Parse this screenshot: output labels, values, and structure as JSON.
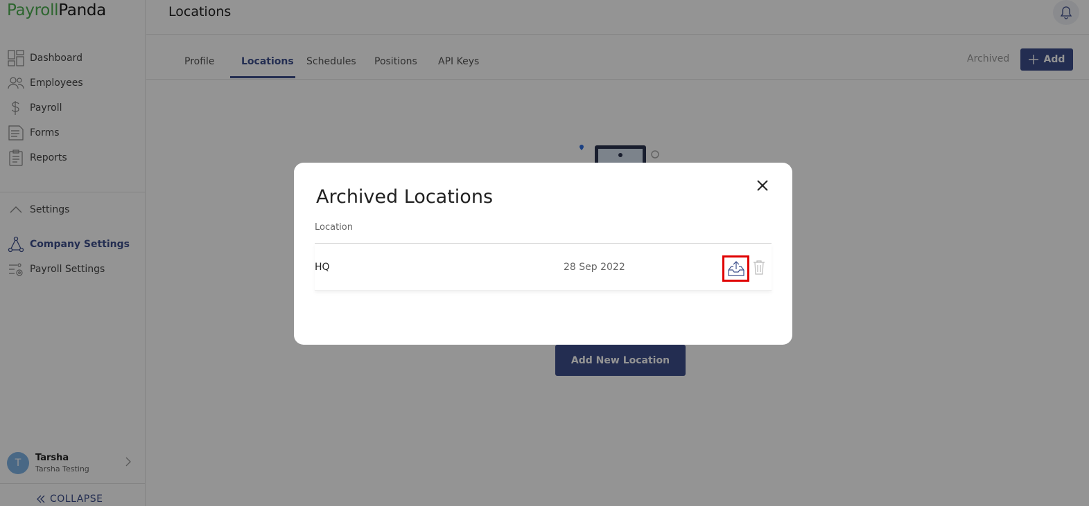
{
  "app": {
    "logo_part1": "Payroll",
    "logo_part2": "Panda"
  },
  "sidebar": {
    "items": [
      {
        "label": "Dashboard",
        "icon": "dashboard-icon"
      },
      {
        "label": "Employees",
        "icon": "employees-icon"
      },
      {
        "label": "Payroll",
        "icon": "dollar-icon"
      },
      {
        "label": "Forms",
        "icon": "forms-icon"
      },
      {
        "label": "Reports",
        "icon": "clipboard-icon"
      }
    ],
    "settings_label": "Settings",
    "settings_items": [
      {
        "label": "Company Settings",
        "icon": "company-settings-icon",
        "active": true
      },
      {
        "label": "Payroll Settings",
        "icon": "payroll-settings-icon"
      }
    ],
    "user": {
      "initial": "T",
      "name": "Tarsha",
      "company": "Tarsha Testing"
    },
    "collapse_label": "COLLAPSE"
  },
  "header": {
    "title": "Locations"
  },
  "tabs": {
    "items": [
      "Profile",
      "Locations",
      "Schedules",
      "Positions",
      "API Keys"
    ],
    "active": "Locations",
    "archived_label": "Archived",
    "add_label": "Add"
  },
  "empty_state": {
    "add_new_location_label": "Add New Location"
  },
  "modal": {
    "title": "Archived Locations",
    "column_header": "Location",
    "rows": [
      {
        "name": "HQ",
        "date": "28 Sep 2022"
      }
    ]
  },
  "colors": {
    "brand_green": "#4caf50",
    "primary": "#3d4f8c",
    "highlight": "#e00000"
  }
}
